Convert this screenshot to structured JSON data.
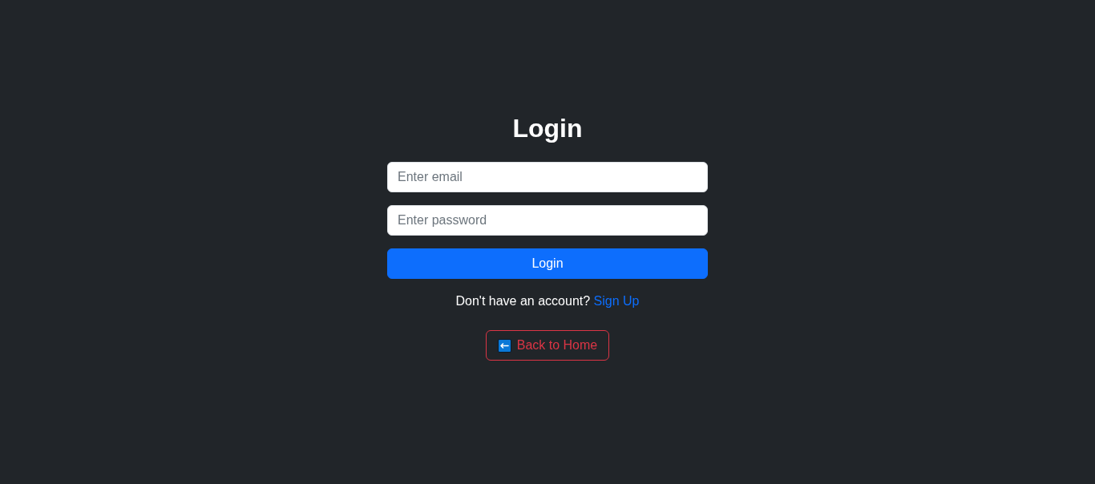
{
  "heading": "Login",
  "form": {
    "fields": [
      {
        "placeholder": "Enter email"
      },
      {
        "placeholder": "Enter password"
      }
    ],
    "submit_button": "Login"
  },
  "signup_prompt": {
    "text": "Don't have an account?",
    "link": "Sign Up"
  },
  "back_button": {
    "label": "Back to Home"
  }
}
